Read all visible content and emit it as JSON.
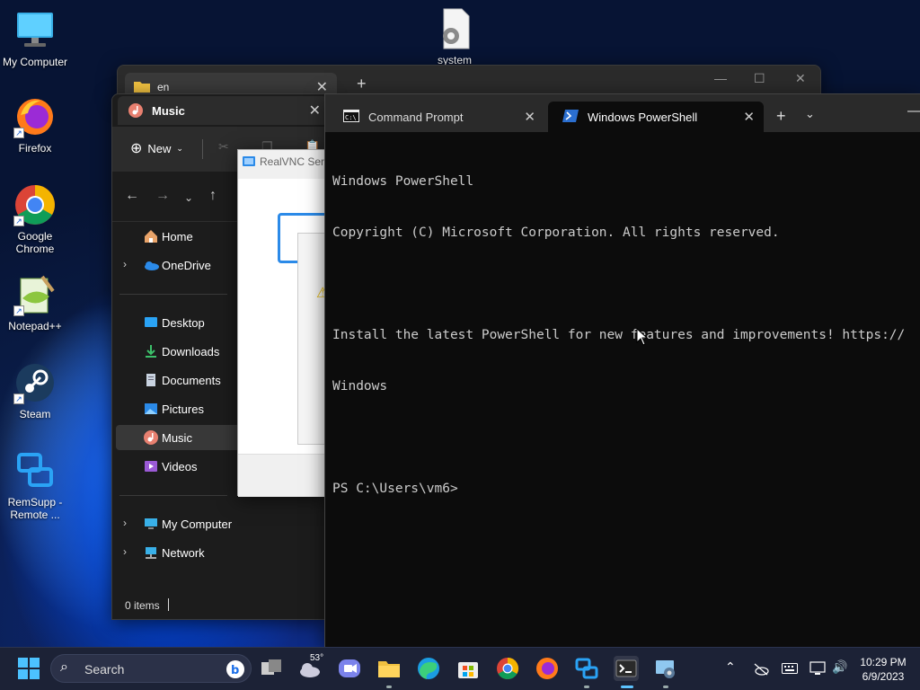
{
  "desktop": {
    "icons": [
      {
        "label": "My Computer"
      },
      {
        "label": "Firefox"
      },
      {
        "label": "Google Chrome"
      },
      {
        "label": "Notepad++"
      },
      {
        "label": "Steam"
      },
      {
        "label": "RemSupp - Remote ..."
      },
      {
        "label": "system"
      }
    ]
  },
  "back_window": {
    "tab_title": "en"
  },
  "explorer": {
    "tab_title": "Music",
    "new_label": "New",
    "sidebar": [
      {
        "label": "Home"
      },
      {
        "label": "OneDrive"
      },
      {
        "label": "Desktop"
      },
      {
        "label": "Downloads"
      },
      {
        "label": "Documents"
      },
      {
        "label": "Pictures"
      },
      {
        "label": "Music"
      },
      {
        "label": "Videos"
      },
      {
        "label": "My Computer"
      },
      {
        "label": "Network"
      }
    ],
    "status": "0 items"
  },
  "vnc_dialog": {
    "title": "RealVNC Serv"
  },
  "terminal": {
    "tabs": [
      {
        "label": "Command Prompt"
      },
      {
        "label": "Windows PowerShell"
      }
    ],
    "lines": [
      "Windows PowerShell",
      "Copyright (C) Microsoft Corporation. All rights reserved.",
      "",
      "Install the latest PowerShell for new features and improvements! https://",
      "Windows",
      "",
      "PS C:\\Users\\vm6>"
    ]
  },
  "taskbar": {
    "search_label": "Search",
    "weather_temp": "53°",
    "clock_time": "10:29 PM",
    "clock_date": "6/9/2023"
  },
  "colors": {
    "accent": "#5cc3ff",
    "terminal_bg": "#0c0c0c",
    "terminal_fg": "#cccccc",
    "taskbar_bg": "#1c2236"
  }
}
